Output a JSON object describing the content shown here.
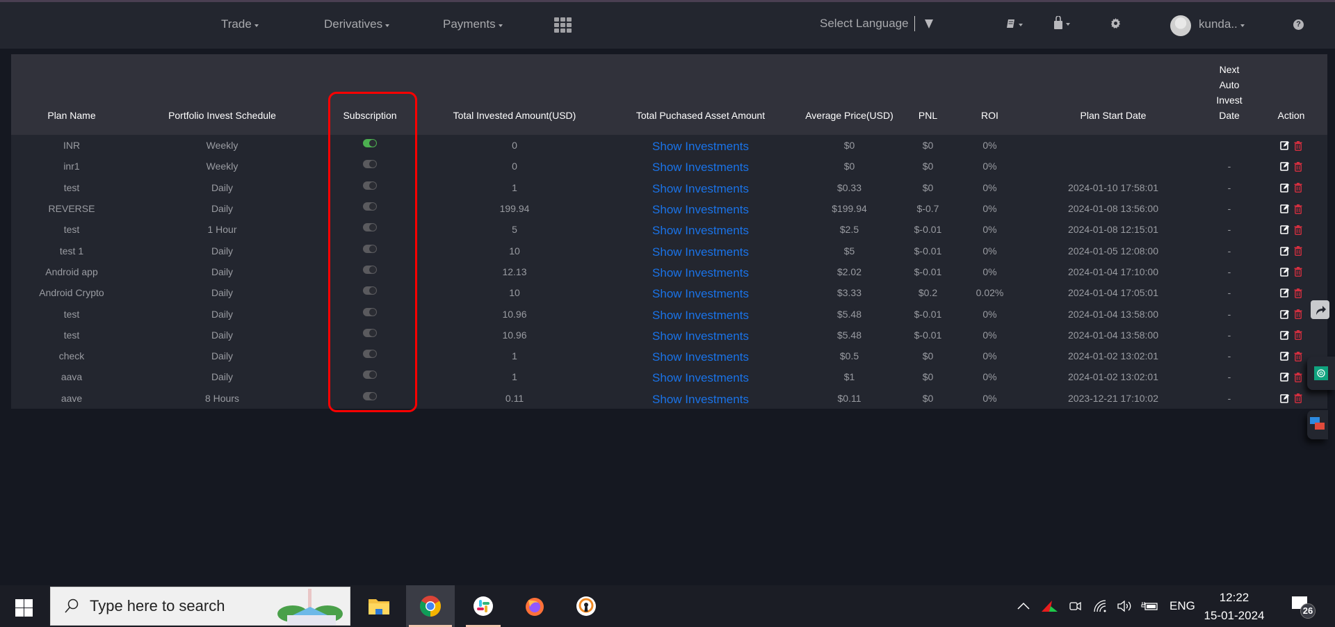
{
  "navbar": {
    "menus": [
      {
        "label": "Trade"
      },
      {
        "label": "Derivatives"
      },
      {
        "label": "Payments"
      }
    ],
    "language_label": "Select Language",
    "user_name": "kunda.."
  },
  "table": {
    "columns": [
      "Plan Name",
      "Portfolio Invest Schedule",
      "Subscription",
      "Total Invested Amount(USD)",
      "Total Puchased Asset Amount",
      "Average Price(USD)",
      "PNL",
      "ROI",
      "Plan Start Date",
      "Next Auto Invest Date",
      "Action"
    ],
    "next_date_header_lines": [
      "Next",
      "Auto",
      "Invest",
      "Date"
    ],
    "link_label": "Show Investments",
    "rows": [
      {
        "name": "INR",
        "schedule": "Weekly",
        "subscribed": true,
        "invested": "0",
        "avg_price": "$0",
        "pnl": "$0",
        "roi": "0%",
        "start_date": "",
        "next_date": ""
      },
      {
        "name": "inr1",
        "schedule": "Weekly",
        "subscribed": false,
        "invested": "0",
        "avg_price": "$0",
        "pnl": "$0",
        "roi": "0%",
        "start_date": "",
        "next_date": "-"
      },
      {
        "name": "test",
        "schedule": "Daily",
        "subscribed": false,
        "invested": "1",
        "avg_price": "$0.33",
        "pnl": "$0",
        "roi": "0%",
        "start_date": "2024-01-10 17:58:01",
        "next_date": "-"
      },
      {
        "name": "REVERSE",
        "schedule": "Daily",
        "subscribed": false,
        "invested": "199.94",
        "avg_price": "$199.94",
        "pnl": "$-0.7",
        "roi": "0%",
        "start_date": "2024-01-08 13:56:00",
        "next_date": "-"
      },
      {
        "name": "test",
        "schedule": "1 Hour",
        "subscribed": false,
        "invested": "5",
        "avg_price": "$2.5",
        "pnl": "$-0.01",
        "roi": "0%",
        "start_date": "2024-01-08 12:15:01",
        "next_date": "-"
      },
      {
        "name": "test 1",
        "schedule": "Daily",
        "subscribed": false,
        "invested": "10",
        "avg_price": "$5",
        "pnl": "$-0.01",
        "roi": "0%",
        "start_date": "2024-01-05 12:08:00",
        "next_date": "-"
      },
      {
        "name": "Android app",
        "schedule": "Daily",
        "subscribed": false,
        "invested": "12.13",
        "avg_price": "$2.02",
        "pnl": "$-0.01",
        "roi": "0%",
        "start_date": "2024-01-04 17:10:00",
        "next_date": "-"
      },
      {
        "name": "Android Crypto",
        "schedule": "Daily",
        "subscribed": false,
        "invested": "10",
        "avg_price": "$3.33",
        "pnl": "$0.2",
        "roi": "0.02%",
        "start_date": "2024-01-04 17:05:01",
        "next_date": "-"
      },
      {
        "name": "test",
        "schedule": "Daily",
        "subscribed": false,
        "invested": "10.96",
        "avg_price": "$5.48",
        "pnl": "$-0.01",
        "roi": "0%",
        "start_date": "2024-01-04 13:58:00",
        "next_date": "-"
      },
      {
        "name": "test",
        "schedule": "Daily",
        "subscribed": false,
        "invested": "10.96",
        "avg_price": "$5.48",
        "pnl": "$-0.01",
        "roi": "0%",
        "start_date": "2024-01-04 13:58:00",
        "next_date": "-"
      },
      {
        "name": "check",
        "schedule": "Daily",
        "subscribed": false,
        "invested": "1",
        "avg_price": "$0.5",
        "pnl": "$0",
        "roi": "0%",
        "start_date": "2024-01-02 13:02:01",
        "next_date": "-"
      },
      {
        "name": "aava",
        "schedule": "Daily",
        "subscribed": false,
        "invested": "1",
        "avg_price": "$1",
        "pnl": "$0",
        "roi": "0%",
        "start_date": "2024-01-02 13:02:01",
        "next_date": "-"
      },
      {
        "name": "aave",
        "schedule": "8 Hours",
        "subscribed": false,
        "invested": "0.11",
        "avg_price": "$0.11",
        "pnl": "$0",
        "roi": "0%",
        "start_date": "2023-12-21 17:10:02",
        "next_date": "-"
      }
    ]
  },
  "colors": {
    "toggle_on": "#4caf50",
    "toggle_off": "#5a5a5e",
    "link": "#1a73e8",
    "delete": "#d32f3f",
    "highlight": "#ff0000"
  },
  "taskbar": {
    "search_placeholder": "Type here to search",
    "apps": [
      "file-explorer",
      "chrome",
      "slack",
      "firefox",
      "openvpn"
    ],
    "language": "ENG",
    "time": "12:22",
    "date": "15-01-2024",
    "notification_count": "26"
  }
}
